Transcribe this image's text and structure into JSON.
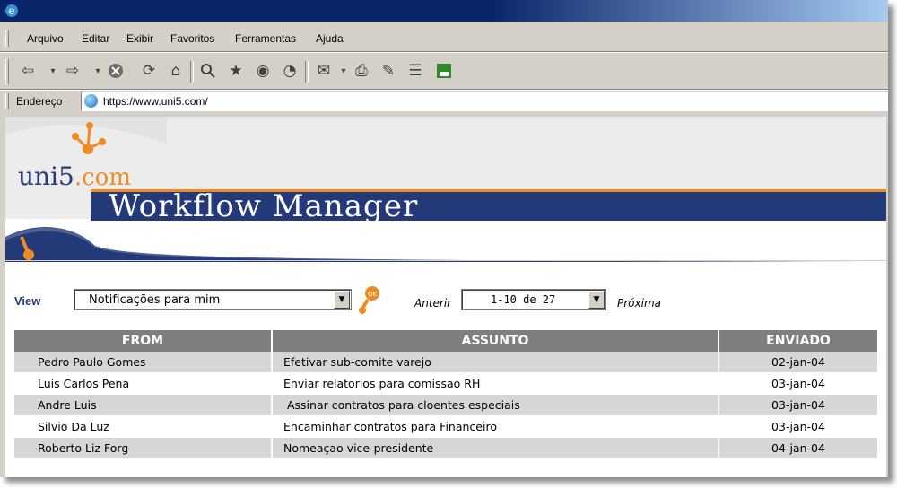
{
  "browser": {
    "menu": [
      {
        "label": "Arquivo"
      },
      {
        "label": "Editar"
      },
      {
        "label": "Exibir"
      },
      {
        "label": "Favoritos"
      },
      {
        "label": "Ferramentas"
      },
      {
        "label": "Ajuda"
      }
    ],
    "address_label": "Endereço",
    "url": "https://www.uni5.com/"
  },
  "banner": {
    "logo_main": "uni5",
    "logo_suffix": ".com",
    "app_title": "Workflow Manager"
  },
  "filter": {
    "view_label": "View",
    "view_value": "Notificações para mim",
    "previous_label": "Anterir",
    "range_value": "1-10 de 27",
    "next_label": "Próxima"
  },
  "table": {
    "headers": [
      "FROM",
      "ASSUNTO",
      "ENVIADO"
    ],
    "rows": [
      [
        "Pedro Paulo Gomes",
        "Efetivar sub-comite varejo",
        "02-jan-04"
      ],
      [
        "Luis Carlos Pena",
        "Enviar relatorios para comissao RH",
        "03-jan-04"
      ],
      [
        "Andre Luis",
        " Assinar contratos para cloentes especiais",
        "03-jan-04"
      ],
      [
        "Silvio Da Luz",
        "Encaminhar contratos para Financeiro",
        "03-jan-04"
      ],
      [
        "Roberto Liz Forg",
        "Nomeaçao vice-presidente",
        "04-jan-04"
      ]
    ]
  },
  "colors": {
    "navy": "#243978",
    "orange": "#f08a24",
    "header_gray": "#7f7f7f",
    "row_gray": "#d6d6d6"
  }
}
